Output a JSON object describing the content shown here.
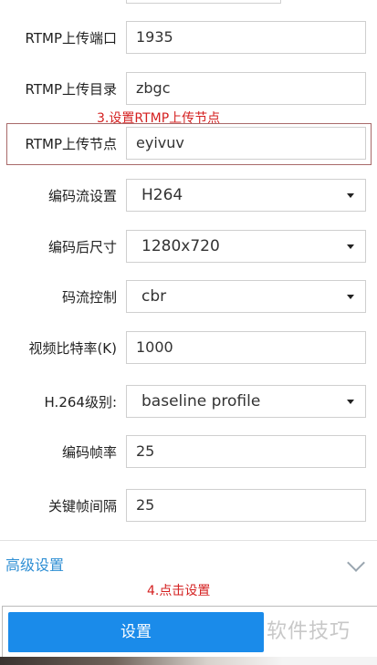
{
  "fields": [
    {
      "id": "rtmp-port",
      "label": "RTMP上传端口",
      "kind": "input",
      "value": "1935"
    },
    {
      "id": "rtmp-dir",
      "label": "RTMP上传目录",
      "kind": "input",
      "value": "zbgc"
    },
    {
      "id": "rtmp-node",
      "label": "RTMP上传节点",
      "kind": "input",
      "value": "eyivuv"
    },
    {
      "id": "encode-stream",
      "label": "编码流设置",
      "kind": "select",
      "value": "H264"
    },
    {
      "id": "encode-size",
      "label": "编码后尺寸",
      "kind": "select",
      "value": "1280x720"
    },
    {
      "id": "bitrate-control",
      "label": "码流控制",
      "kind": "select",
      "value": "cbr"
    },
    {
      "id": "video-bitrate",
      "label": "视频比特率(K)",
      "kind": "input",
      "value": "1000"
    },
    {
      "id": "h264-level",
      "label": "H.264级别:",
      "kind": "select",
      "value": "baseline profile"
    },
    {
      "id": "encode-fps",
      "label": "编码帧率",
      "kind": "input",
      "value": "25"
    },
    {
      "id": "keyframe-interval",
      "label": "关键帧间隔",
      "kind": "input",
      "value": "25"
    }
  ],
  "annotations": {
    "step3": "3.设置RTMP上传节点",
    "step4": "4.点击设置"
  },
  "advanced": {
    "label": "高级设置"
  },
  "submit": {
    "label": "设置"
  },
  "watermark": "软件技巧",
  "colors": {
    "primary": "#1a8bea",
    "link": "#2f8fd4",
    "annotation": "#d42020"
  }
}
